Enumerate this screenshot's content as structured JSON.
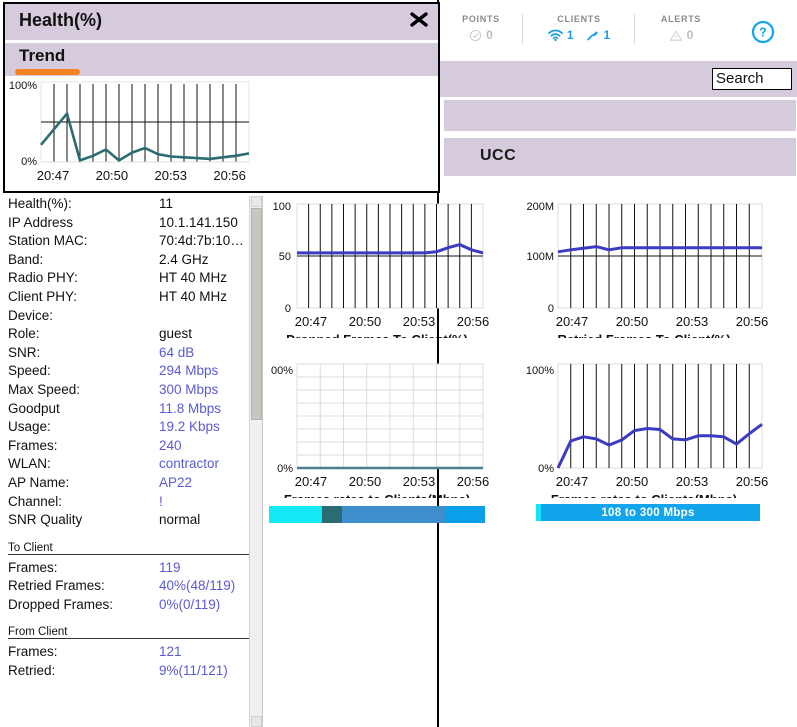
{
  "app_header": {
    "groups": [
      {
        "label": "POINTS",
        "icon": "check-circle-icon",
        "value": "0",
        "active": false
      },
      {
        "label": "CLIENTS",
        "icon": "wifi-icon",
        "value": "1",
        "active": true,
        "icon2": "connector-pin-icon",
        "value2": "1",
        "active2": true
      },
      {
        "label": "ALERTS",
        "icon": "warning-triangle-icon",
        "value": "0",
        "active": false
      }
    ],
    "help_icon": "help-circle-icon",
    "accent_color": "#1a9ee0"
  },
  "search": {
    "label": "Search",
    "icon": "search-icon"
  },
  "panels": {
    "blank_bar": "",
    "ucc": "UCC",
    "bar_color": "#d6cbdc"
  },
  "dialog": {
    "title": "Health(%)",
    "close_icon": "close-icon",
    "section": "Trend",
    "accent_color": "#f58220",
    "chart": {
      "type": "line",
      "title": "Trend",
      "ylabel_top": "100%",
      "ylabel_bottom": "0%",
      "xlabels": [
        "20:47",
        "20:50",
        "20:53",
        "20:56"
      ],
      "ylim": [
        0,
        100
      ],
      "series_color": "#2d6b75",
      "values": [
        22,
        42,
        62,
        2,
        8,
        16,
        2,
        12,
        18,
        10,
        7,
        6,
        5,
        4,
        6,
        8,
        11
      ]
    }
  },
  "details": {
    "rows": [
      {
        "key": "Health(%):",
        "value": "11",
        "blue": false
      },
      {
        "key": "IP Address",
        "value": "10.1.141.150",
        "blue": false
      },
      {
        "key": "Station MAC:",
        "value": "70:4d:7b:10…",
        "blue": false
      },
      {
        "key": "Band:",
        "value": "2.4 GHz",
        "blue": false
      },
      {
        "key": "Radio PHY:",
        "value": "HT 40 MHz",
        "blue": false
      },
      {
        "key": "Client PHY:",
        "value": "HT 40 MHz",
        "blue": false
      },
      {
        "key": "Device:",
        "value": "",
        "blue": false
      },
      {
        "key": "Role:",
        "value": "guest",
        "blue": false
      },
      {
        "key": "SNR:",
        "value": "64 dB",
        "blue": true
      },
      {
        "key": "Speed:",
        "value": "294 Mbps",
        "blue": true
      },
      {
        "key": "Max Speed:",
        "value": "300 Mbps",
        "blue": true
      },
      {
        "key": "Goodput",
        "value": "11.8 Mbps",
        "blue": true
      },
      {
        "key": "Usage:",
        "value": "19.2 Kbps",
        "blue": true
      },
      {
        "key": "Frames:",
        "value": "240",
        "blue": true
      },
      {
        "key": "WLAN:",
        "value": "contractor",
        "blue": true
      },
      {
        "key": "AP Name:",
        "value": "AP22",
        "blue": true
      },
      {
        "key": "Channel:",
        "value": "!",
        "blue": true
      },
      {
        "key": "SNR Quality",
        "value": "normal",
        "blue": false
      }
    ],
    "to_client": {
      "title": "To Client",
      "rows": [
        {
          "key": "Frames:",
          "value": "119",
          "blue": true
        },
        {
          "key": "Retried Frames:",
          "value": "40%(48/119)",
          "blue": true
        },
        {
          "key": "Dropped Frames:",
          "value": "0%(0/119)",
          "blue": true
        }
      ]
    },
    "from_client": {
      "title": "From Client",
      "rows": [
        {
          "key": "Frames:",
          "value": "121",
          "blue": true
        },
        {
          "key": "Retried:",
          "value": "9%(11/121)",
          "blue": true
        }
      ]
    }
  },
  "chart_data": [
    {
      "id": "dropped-frames-to-client",
      "type": "line",
      "title": "Dropped Frames To Client(%)",
      "xlabel": "",
      "ylabel": "",
      "xlabels": [
        "20:47",
        "20:50",
        "20:53",
        "20:56"
      ],
      "yticks": [
        "0",
        "50",
        "100"
      ],
      "ylim": [
        0,
        100
      ],
      "grid": true,
      "series_color": "#3b3bc4",
      "x": [
        0,
        1,
        2,
        3,
        4,
        5,
        6,
        7,
        8,
        9,
        10,
        11,
        12,
        13,
        14,
        15,
        16
      ],
      "values": [
        53,
        53,
        53,
        53,
        53,
        53,
        53,
        53,
        53,
        53,
        53,
        53,
        54,
        58,
        61,
        56,
        53
      ]
    },
    {
      "id": "retried-frames-to-client",
      "type": "line",
      "title": "Retried Frames To Client(%)",
      "xlabel": "",
      "ylabel": "",
      "xlabels": [
        "20:47",
        "20:50",
        "20:53",
        "20:56"
      ],
      "yticks": [
        "0",
        "100M",
        "200M"
      ],
      "ylim": [
        0,
        200
      ],
      "grid": true,
      "series_color": "#3b3bc4",
      "x": [
        0,
        1,
        2,
        3,
        4,
        5,
        6,
        7,
        8,
        9,
        10,
        11,
        12,
        13,
        14,
        15,
        16
      ],
      "values": [
        108,
        112,
        115,
        118,
        112,
        116,
        116,
        116,
        116,
        116,
        116,
        116,
        116,
        116,
        116,
        116,
        116
      ]
    },
    {
      "id": "frames-rates-to-clients-left",
      "type": "line",
      "title": "Frames rates to Clients(Mbps)",
      "xlabel": "",
      "ylabel": "",
      "xlabels": [
        "20:47",
        "20:50",
        "20:53",
        "20:56"
      ],
      "yticks": [
        "0%",
        "00%"
      ],
      "ylim": [
        0,
        100
      ],
      "grid": true,
      "series_color": "#4a7f8c",
      "x": [
        0,
        1,
        2,
        3,
        4,
        5,
        6,
        7,
        8,
        9,
        10,
        11,
        12,
        13,
        14,
        15,
        16
      ],
      "values": [
        0,
        0,
        0,
        0,
        0,
        0,
        0,
        0,
        0,
        0,
        0,
        0,
        0,
        0,
        0,
        0,
        0
      ],
      "legend": {
        "type": "stacked-bar",
        "segments": [
          {
            "color": "#15e8f5",
            "fraction": 0.245
          },
          {
            "color": "#2a6b74",
            "fraction": 0.095
          },
          {
            "color": "#3d8ecb",
            "fraction": 0.475
          },
          {
            "color": "#0a9fe8",
            "fraction": 0.185
          }
        ]
      }
    },
    {
      "id": "frames-rates-to-clients-right",
      "type": "line",
      "title": "Frames rates to Clients(Mbps)",
      "xlabel": "",
      "ylabel": "",
      "xlabels": [
        "20:47",
        "20:50",
        "20:53",
        "20:56"
      ],
      "yticks": [
        "0%",
        "100%"
      ],
      "ylim": [
        0,
        100
      ],
      "grid": true,
      "series_color": "#3b3bc4",
      "x": [
        0,
        1,
        2,
        3,
        4,
        5,
        6,
        7,
        8,
        9,
        10,
        11,
        12,
        13,
        14,
        15,
        16
      ],
      "values": [
        0,
        26,
        30,
        28,
        22,
        27,
        36,
        38,
        37,
        28,
        27,
        31,
        31,
        30,
        23,
        33,
        42
      ],
      "legend": {
        "type": "single-label",
        "label": "108 to 300 Mbps",
        "color": "#13a5ec"
      }
    }
  ]
}
